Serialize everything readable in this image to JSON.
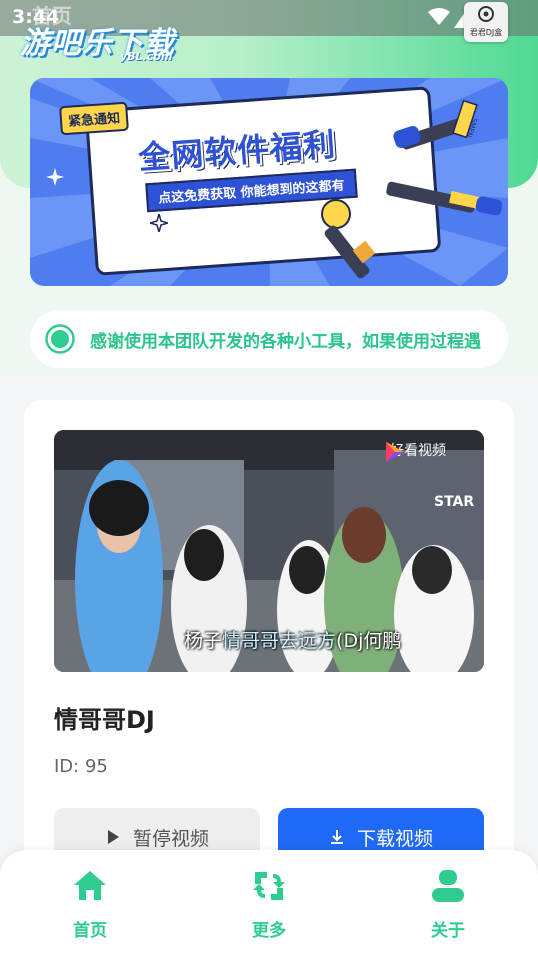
{
  "status_bar": {
    "time": "3:44",
    "app_badge_label": "君君DJ盒"
  },
  "page_label": "首页",
  "watermark": {
    "logo": "游吧乐下载",
    "sub": "yBL.com"
  },
  "banner": {
    "tag": "紧急通知",
    "title": "全网软件福利",
    "subtitle": "点这免费获取 你能想到的这都有",
    "mic_label": "SMEN"
  },
  "notice": {
    "text": "感谢使用本团队开发的各种小工具，如果使用过程遇"
  },
  "video": {
    "thumbnail_brand": "好看视频",
    "caption_prefix": "杨子",
    "caption_highlight": "情哥哥去远方",
    "caption_suffix": "(Dj何鹏",
    "storefront_sign": "STAR",
    "title": "情哥哥DJ",
    "id_text": "ID: 95"
  },
  "buttons": {
    "pause": "暂停视频",
    "download": "下载视频"
  },
  "bottom_nav": {
    "items": [
      {
        "label": "首页",
        "icon": "home-icon"
      },
      {
        "label": "更多",
        "icon": "refresh-icon"
      },
      {
        "label": "关于",
        "icon": "user-icon"
      }
    ]
  },
  "colors": {
    "accent_green": "#2ecc8f",
    "download_blue": "#1f6af5",
    "banner_blue": "#4f7df0"
  }
}
